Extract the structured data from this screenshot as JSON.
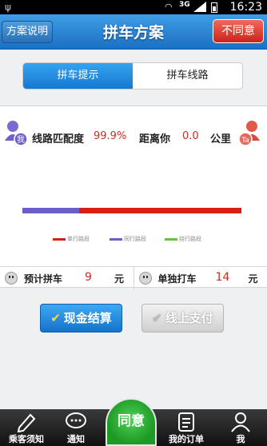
{
  "status_bar": {
    "network": "3G",
    "time": "16:23"
  },
  "header": {
    "left_button": "方案说明",
    "title": "拼车方案",
    "right_button": "不同意"
  },
  "tabs": [
    {
      "label": "拼车提示",
      "active": true
    },
    {
      "label": "拼车线路",
      "active": false
    }
  ],
  "match": {
    "avatar_me": "我",
    "avatar_ta": "Ta",
    "match_label": "线路匹配度",
    "match_value": "99.9%",
    "distance_label": "距离你",
    "distance_value": "0.0",
    "distance_unit": "公里"
  },
  "route": {
    "shared_fraction": 0.26,
    "legend": [
      {
        "label": "单行路段",
        "color": "#d91f13"
      },
      {
        "label": "同行路段",
        "color": "#6a5fc8"
      },
      {
        "label": "绕行路段",
        "color": "#67c23a"
      }
    ]
  },
  "prices": {
    "carpool_label": "预计拼车",
    "carpool_value": "9",
    "carpool_unit": "元",
    "solo_label": "单独打车",
    "solo_value": "14",
    "solo_unit": "元"
  },
  "payment": {
    "cash": "现金结算",
    "online": "线上支付"
  },
  "nav": {
    "items": [
      {
        "label": "乘客须知",
        "icon": "pencil-icon"
      },
      {
        "label": "通知",
        "icon": "chat-bubble-icon"
      },
      {
        "label": "我的订单",
        "icon": "order-list-icon"
      },
      {
        "label": "我",
        "icon": "person-icon"
      }
    ],
    "center": "同意"
  }
}
